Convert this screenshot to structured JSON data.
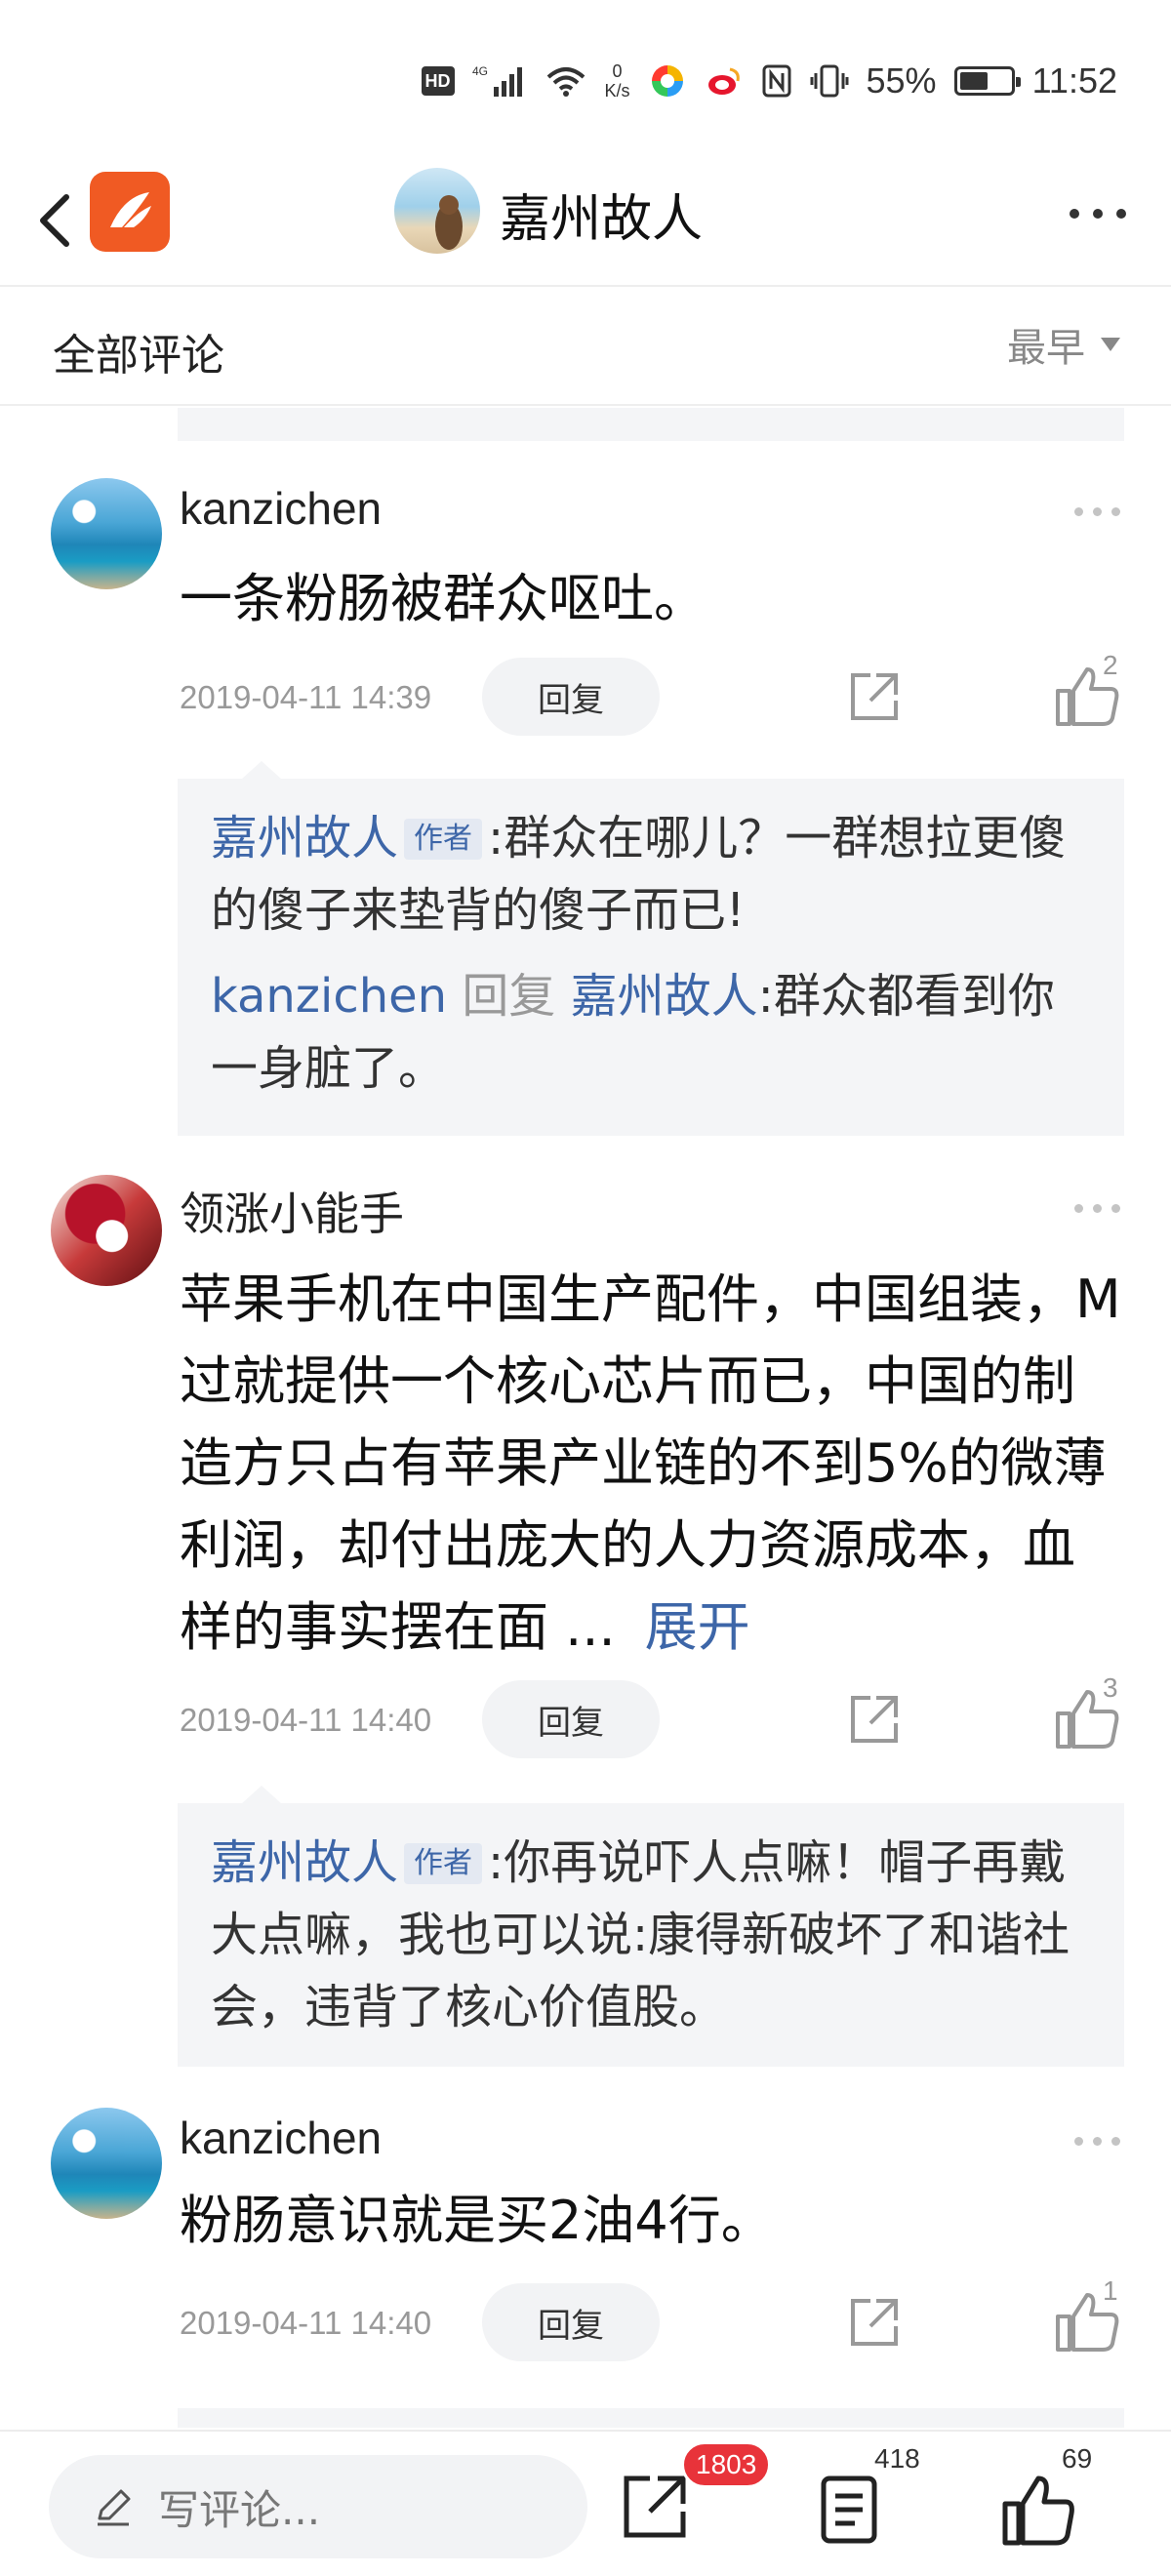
{
  "status_bar": {
    "hd": "HD",
    "network": "4G",
    "speed_value": "0",
    "speed_unit": "K/s",
    "battery": "55%",
    "battery_level": 0.55,
    "time": "11:52"
  },
  "nav": {
    "title": "嘉州故人"
  },
  "section": {
    "title": "全部评论",
    "sort_label": "最早"
  },
  "comments": [
    {
      "author": "kanzichen",
      "text": "一条粉肠被群众呕吐。",
      "date": "2019-04-11 14:39",
      "reply_label": "回复",
      "likes": "2",
      "replies": [
        {
          "name": "嘉州故人",
          "tag": "作者",
          "text": ":群众在哪儿？一群想拉更傻的傻子来垫背的傻子而已!"
        },
        {
          "name": "kanzichen",
          "reply_word": "回复",
          "target": "嘉州故人",
          "text": ":群众都看到你一身脏了。"
        }
      ]
    },
    {
      "author": "领涨小能手",
      "text": "苹果手机在中国生产配件，中国组装，M过就提供一个核心芯片而已，中国的制造方只占有苹果产业链的不到5%的微薄利润，却付出庞大的人力资源成本，血样的事实摆在面 ...",
      "expand_label": "展开",
      "date": "2019-04-11 14:40",
      "reply_label": "回复",
      "likes": "3",
      "replies": [
        {
          "name": "嘉州故人",
          "tag": "作者",
          "text": ":你再说吓人点嘛！帽子再戴大点嘛，我也可以说:康得新破坏了和谐社会，违背了核心价值股。"
        }
      ]
    },
    {
      "author": "kanzichen",
      "text": "粉肠意识就是买2油4行。",
      "date": "2019-04-11 14:40",
      "reply_label": "回复",
      "likes": "1"
    }
  ],
  "bottom_bar": {
    "input_placeholder": "写评论...",
    "share_badge": "1803",
    "comments_count": "418",
    "likes_count": "69"
  },
  "colors": {
    "accent_blue": "#3d66a8",
    "badge_red": "#e8333a",
    "app_orange": "#f05a23"
  }
}
